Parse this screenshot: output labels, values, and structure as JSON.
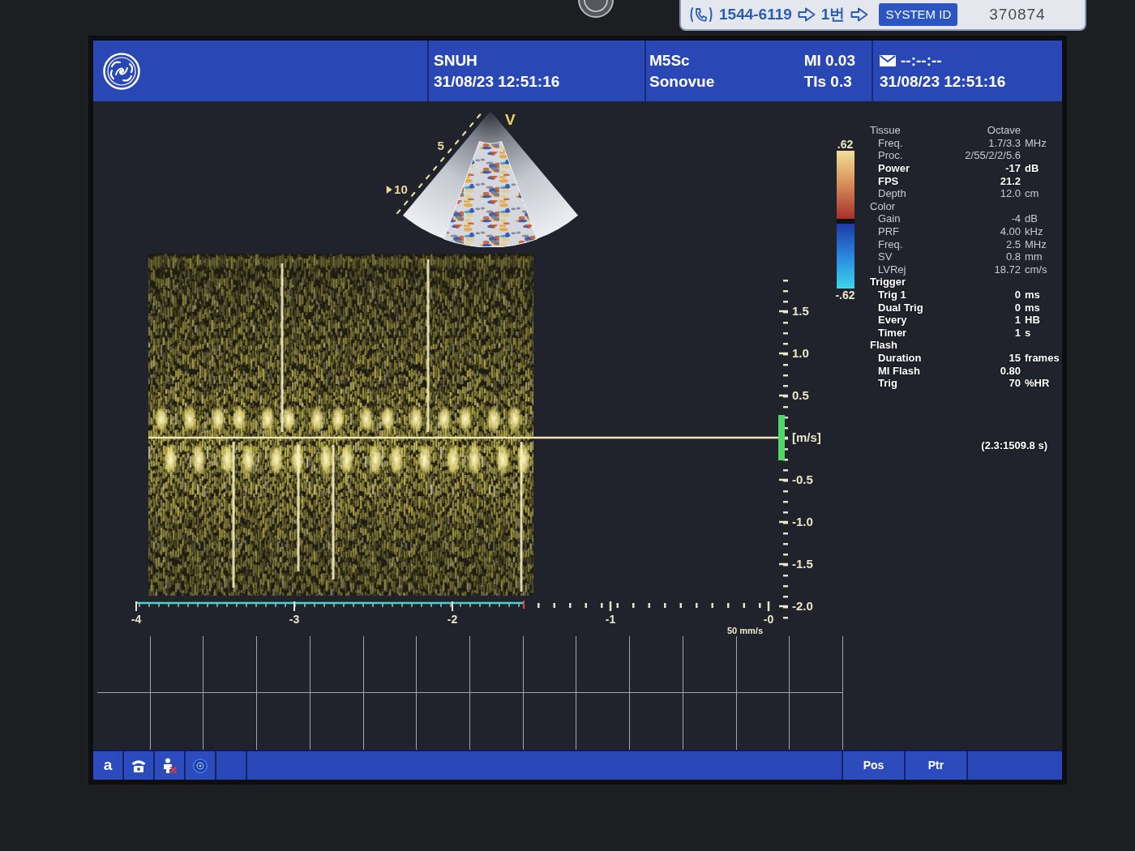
{
  "sticker": {
    "phone": "1544-6119",
    "step": "1번",
    "system_id_label": "SYSTEM ID",
    "system_id": "370874"
  },
  "header": {
    "site": "SNUH",
    "site_time": "31/08/23 12:51:16",
    "probe": "M5Sc",
    "preset": "Sonovue",
    "mi": "MI 0.03",
    "tis": "TIs 0.3",
    "timer": "--:--:--",
    "time": "31/08/23 12:51:16"
  },
  "sector_image": {
    "orientation_mark": "V",
    "depth_labels": [
      "5",
      "10"
    ]
  },
  "color_map": {
    "max": ".62",
    "min": "-.62"
  },
  "spectrum": {
    "velocity_labels": [
      "1.5",
      "1.0",
      "0.5",
      "[m/s]",
      "-0.5",
      "-1.0",
      "-1.5",
      "-2.0"
    ],
    "time_labels": [
      "-4",
      "-3",
      "-2",
      "-1",
      "-0"
    ],
    "sweep_speed": "50 mm/s"
  },
  "parameters": [
    {
      "label": "Tissue",
      "value": "Octave",
      "highlighted": false,
      "children": [
        {
          "label": "Freq.",
          "value": "1.7/3.3",
          "unit": "MHz",
          "highlighted": false
        },
        {
          "label": "Proc.",
          "value": "2/55/2/2/5.6",
          "highlighted": false
        },
        {
          "label": "Power",
          "value": "-17",
          "unit": "dB",
          "highlighted": true
        },
        {
          "label": "FPS",
          "value": "21.2",
          "highlighted": true
        },
        {
          "label": "Depth",
          "value": "12.0",
          "unit": "cm",
          "highlighted": false
        }
      ]
    },
    {
      "label": "Color",
      "highlighted": false,
      "children": [
        {
          "label": "Gain",
          "value": "-4",
          "unit": "dB",
          "highlighted": false
        },
        {
          "label": "PRF",
          "value": "4.00",
          "unit": "kHz",
          "highlighted": false
        },
        {
          "label": "Freq.",
          "value": "2.5",
          "unit": "MHz",
          "highlighted": false
        },
        {
          "label": "SV",
          "value": "0.8",
          "unit": "mm",
          "highlighted": false
        },
        {
          "label": "LVRej",
          "value": "18.72",
          "unit": "cm/s",
          "highlighted": false
        }
      ]
    },
    {
      "label": "Trigger",
      "highlighted": true,
      "children": [
        {
          "label": "Trig 1",
          "value": "0",
          "unit": "ms",
          "highlighted": true
        },
        {
          "label": "Dual Trig",
          "value": "0",
          "unit": "ms",
          "highlighted": true
        },
        {
          "label": "Every",
          "value": "1",
          "unit": "HB",
          "highlighted": true
        },
        {
          "label": "Timer",
          "value": "1",
          "unit": "s",
          "highlighted": true
        }
      ]
    },
    {
      "label": "Flash",
      "highlighted": true,
      "children": [
        {
          "label": "Duration",
          "value": "15",
          "unit": "frames",
          "highlighted": true
        },
        {
          "label": "MI Flash",
          "value": "0.80",
          "highlighted": true
        },
        {
          "label": "Trig",
          "value": "70",
          "unit": "%HR",
          "highlighted": true
        }
      ]
    }
  ],
  "cine_range": "(2.3:1509.8 s)",
  "toolbar": {
    "mode_key": "a",
    "softkeys": [
      "Pos",
      "Ptr"
    ]
  }
}
